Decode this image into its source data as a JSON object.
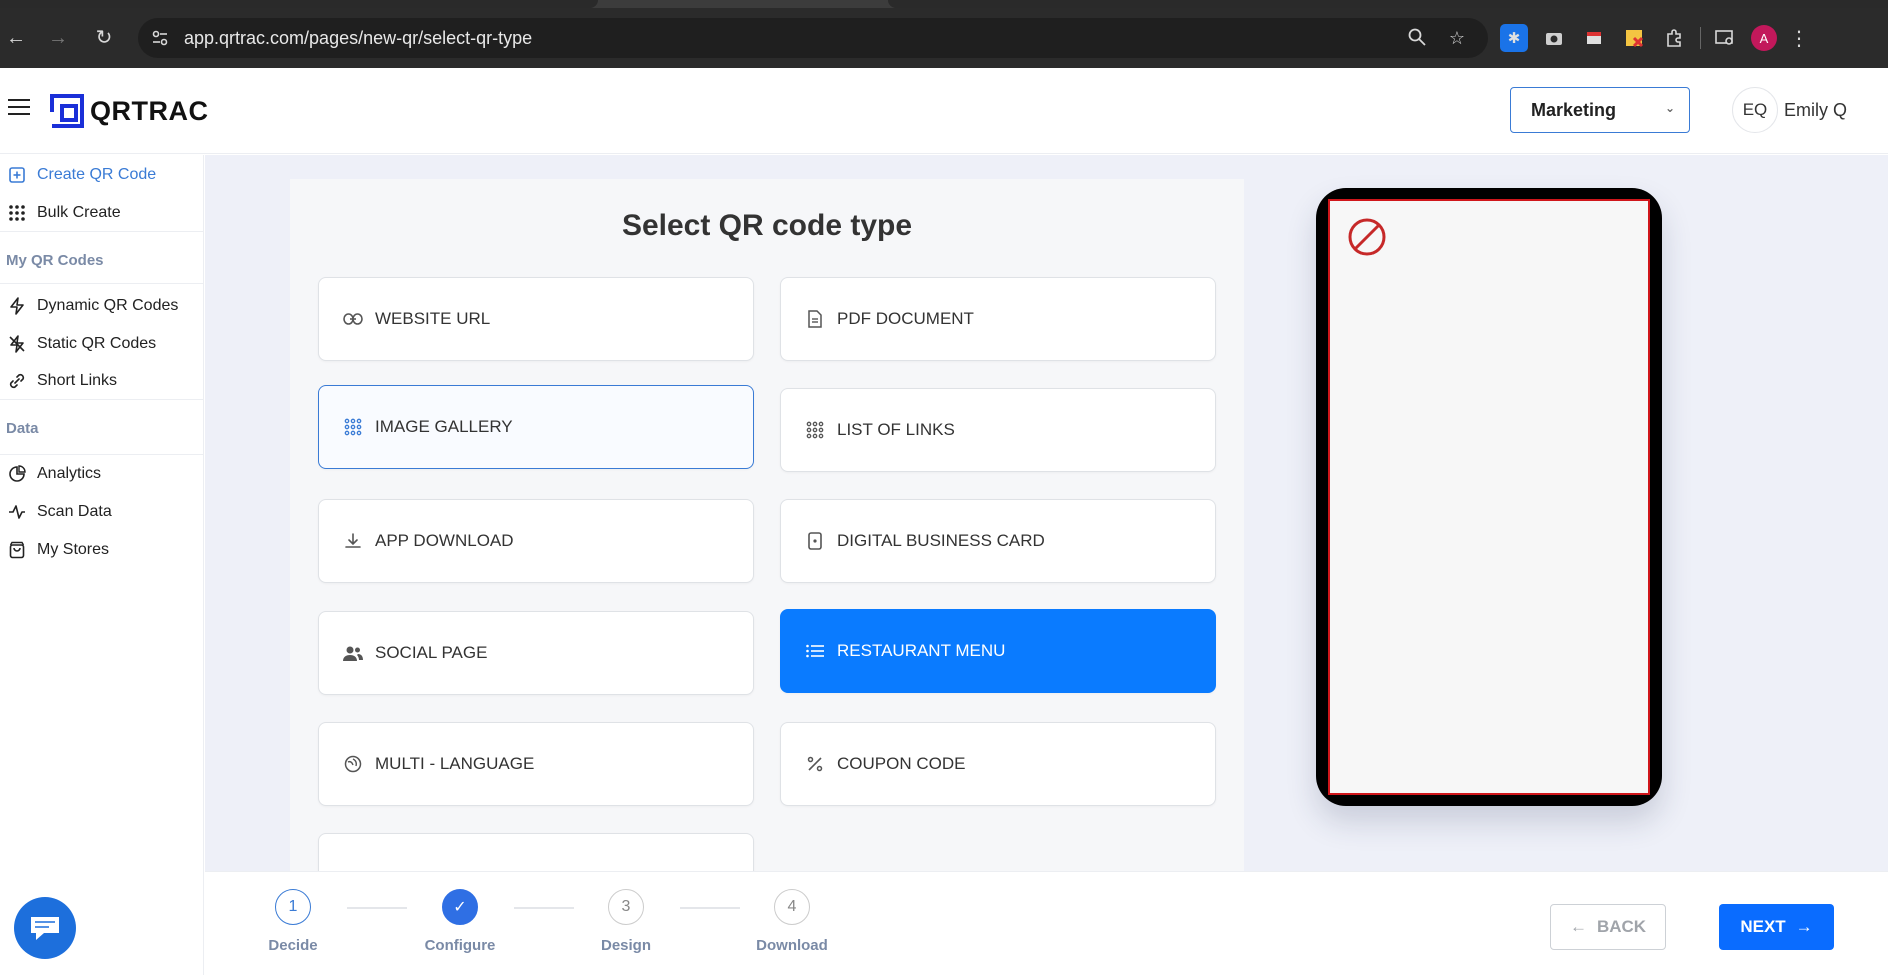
{
  "browser": {
    "url": "app.qrtrac.com/pages/new-qr/select-qr-type",
    "profile_initial": "A"
  },
  "header": {
    "logo_text": "QRTRAC",
    "workspace": "Marketing",
    "user_initials": "EQ",
    "user_name": "Emily Q"
  },
  "sidebar": {
    "items": [
      {
        "label": "Create QR Code",
        "icon": "plus-square-icon"
      },
      {
        "label": "Bulk Create",
        "icon": "grid-dots-icon"
      },
      {
        "label": "Dynamic QR Codes",
        "icon": "bolt-icon"
      },
      {
        "label": "Static QR Codes",
        "icon": "bolt-off-icon"
      },
      {
        "label": "Short Links",
        "icon": "link-icon"
      },
      {
        "label": "Analytics",
        "icon": "pie-chart-icon"
      },
      {
        "label": "Scan Data",
        "icon": "activity-icon"
      },
      {
        "label": "My Stores",
        "icon": "shopping-bag-icon"
      }
    ],
    "sections": [
      "My QR Codes",
      "Data"
    ]
  },
  "main": {
    "title": "Select QR code type",
    "types": [
      {
        "label": "WEBSITE URL",
        "icon": "link-icon"
      },
      {
        "label": "PDF DOCUMENT",
        "icon": "document-icon"
      },
      {
        "label": "IMAGE GALLERY",
        "icon": "grid-dots-icon"
      },
      {
        "label": "LIST OF LINKS",
        "icon": "grid-dots-icon"
      },
      {
        "label": "APP DOWNLOAD",
        "icon": "download-icon"
      },
      {
        "label": "DIGITAL BUSINESS CARD",
        "icon": "id-card-icon"
      },
      {
        "label": "SOCIAL PAGE",
        "icon": "users-icon"
      },
      {
        "label": "RESTAURANT MENU",
        "icon": "list-icon"
      },
      {
        "label": "MULTI - LANGUAGE",
        "icon": "language-icon"
      },
      {
        "label": "COUPON CODE",
        "icon": "percent-icon"
      }
    ],
    "selected_type": "RESTAURANT MENU"
  },
  "stepper": {
    "steps": [
      {
        "number": "1",
        "label": "Decide",
        "state": "current"
      },
      {
        "number": "✓",
        "label": "Configure",
        "state": "done"
      },
      {
        "number": "3",
        "label": "Design",
        "state": "pending"
      },
      {
        "number": "4",
        "label": "Download",
        "state": "pending"
      }
    ],
    "back_label": "BACK",
    "next_label": "NEXT"
  },
  "colors": {
    "accent": "#0a7bff",
    "primary_button": "#0a6cff",
    "active_link": "#3a7bd5",
    "error_red": "#d0161b"
  }
}
